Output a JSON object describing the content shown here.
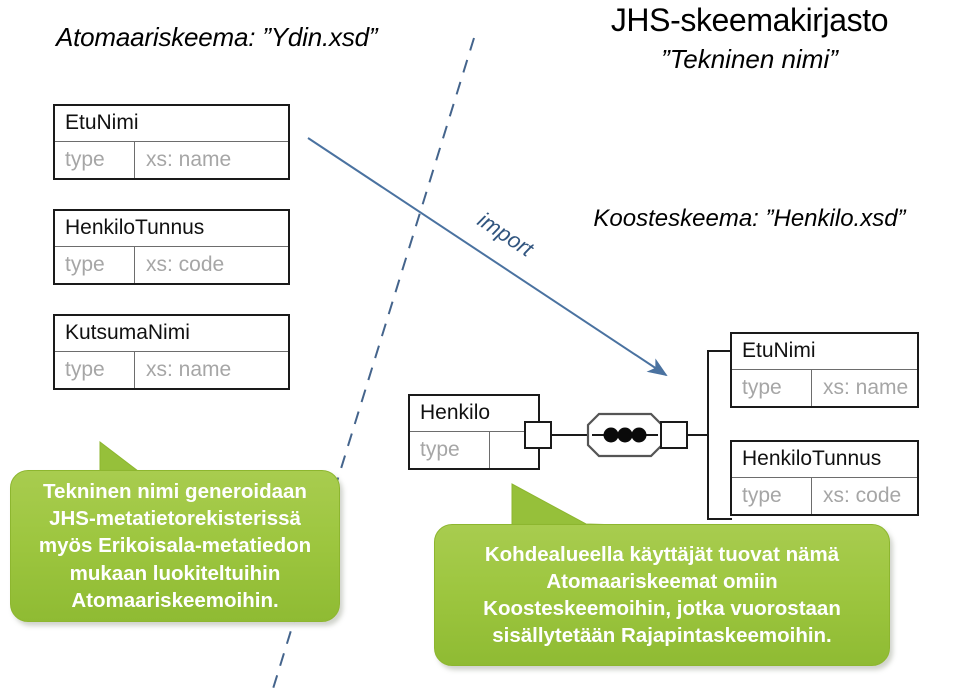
{
  "headings": {
    "atomic_schema": "Atomaariskeema: ”Ydin.xsd”",
    "library_title": "JHS-skeemakirjasto",
    "library_subtitle": "”Tekninen nimi”",
    "composite_schema": "Koosteskeema: ”Henkilo.xsd”"
  },
  "connector": {
    "import_label": "import"
  },
  "atomic_boxes": [
    {
      "name": "EtuNimi",
      "key": "type",
      "value": "xs: name"
    },
    {
      "name": "HenkiloTunnus",
      "key": "type",
      "value": "xs: code"
    },
    {
      "name": "KutsumaNimi",
      "key": "type",
      "value": "xs: name"
    }
  ],
  "composite_root": {
    "name": "Henkilo",
    "key": "type",
    "value": ""
  },
  "composite_children": [
    {
      "name": "EtuNimi",
      "key": "type",
      "value": "xs: name"
    },
    {
      "name": "HenkiloTunnus",
      "key": "type",
      "value": "xs: code"
    }
  ],
  "callouts": {
    "left": "Tekninen nimi generoidaan\nJHS-metatietorekisterissä\nmyös Erikoisala-metatiedon\nmukaan luokiteltuihin\nAtomaariskeemoihin.",
    "bottom": "Kohdealueella käyttäjät tuovat nämä\nAtomaariskeemat omiin\nKoosteskeemoihin, jotka vuorostaan\nsisällytetään Rajapintaskeemoihin."
  },
  "colors": {
    "callout_green": "#9dc63f",
    "connector_blue": "#44648c",
    "muted_text": "#a6a6a6"
  }
}
